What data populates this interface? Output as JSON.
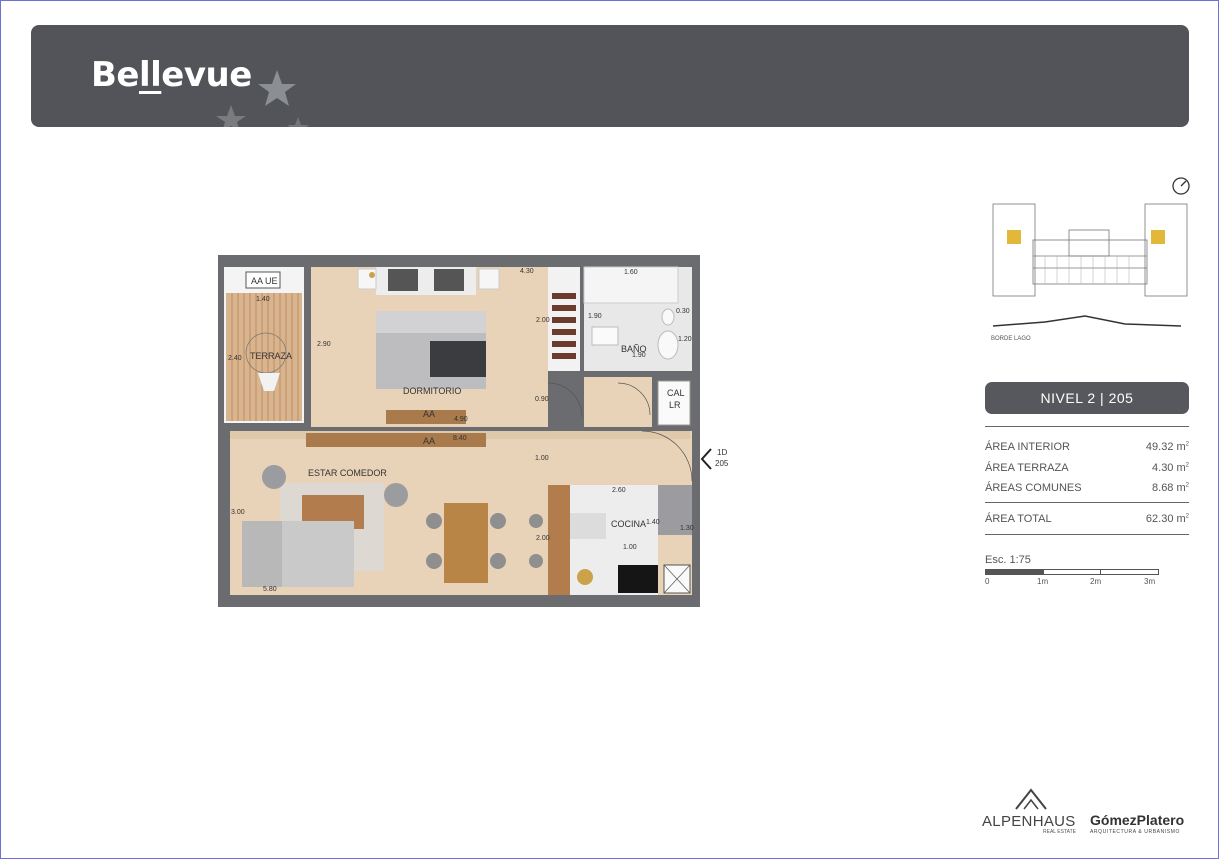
{
  "header": {
    "brand_prefix": "Be",
    "brand_ll": "ll",
    "brand_suffix": "evue"
  },
  "plan": {
    "rooms": {
      "aa_ue": "AA UE",
      "terraza": "TERRAZA",
      "dormitorio": "DORMITORIO",
      "bano": "BAÑO",
      "estar_comedor": "ESTAR COMEDOR",
      "cocina": "COCINA",
      "aa_1": "AA",
      "aa_2": "AA",
      "cal_1": "CAL",
      "cal_2": "LR"
    },
    "dims": {
      "d_1_40": "1.40",
      "d_2_40": "2.40",
      "d_2_90": "2.90",
      "d_4_30": "4.30",
      "d_2_00": "2.00",
      "d_4_90": "4.90",
      "d_1_60": "1.60",
      "d_1_90a": "1.90",
      "d_0_30": "0.30",
      "d_1_20": "1.20",
      "d_1_90b": "1.90",
      "d_0_90": "0.90",
      "d_8_40": "8.40",
      "d_1_00a": "1.00",
      "d_3_00": "3.00",
      "d_5_80": "5.80",
      "d_2_60": "2.60",
      "d_1_40b": "1.40",
      "d_1_30": "1.30",
      "d_2_00b": "2.00",
      "d_1_00b": "1.00"
    },
    "unit_marker_1": "1D",
    "unit_marker_2": "205"
  },
  "keyplan": {
    "borde_label": "BORDE LAGO"
  },
  "nivel": {
    "label": "NIVEL 2 | 205"
  },
  "areas": [
    {
      "label": "ÁREA INTERIOR",
      "value": "49.32 m",
      "unit_sup": "2"
    },
    {
      "label": "ÁREA TERRAZA",
      "value": "4.30 m",
      "unit_sup": "2"
    },
    {
      "label": "ÁREAS COMUNES",
      "value": "8.68 m",
      "unit_sup": "2"
    }
  ],
  "total": {
    "label": "ÁREA TOTAL",
    "value": "62.30 m",
    "unit_sup": "2"
  },
  "scale": {
    "label": "Esc. 1:75",
    "ticks": [
      "0",
      "1m",
      "2m",
      "3m"
    ]
  },
  "logos": {
    "alpenhaus": "ALPENHAUS",
    "alpenhaus_sub": "REAL ESTATE",
    "gomez": "GómezPlatero",
    "gomez_sub": "ARQUITECTURA & URBANISMO"
  }
}
